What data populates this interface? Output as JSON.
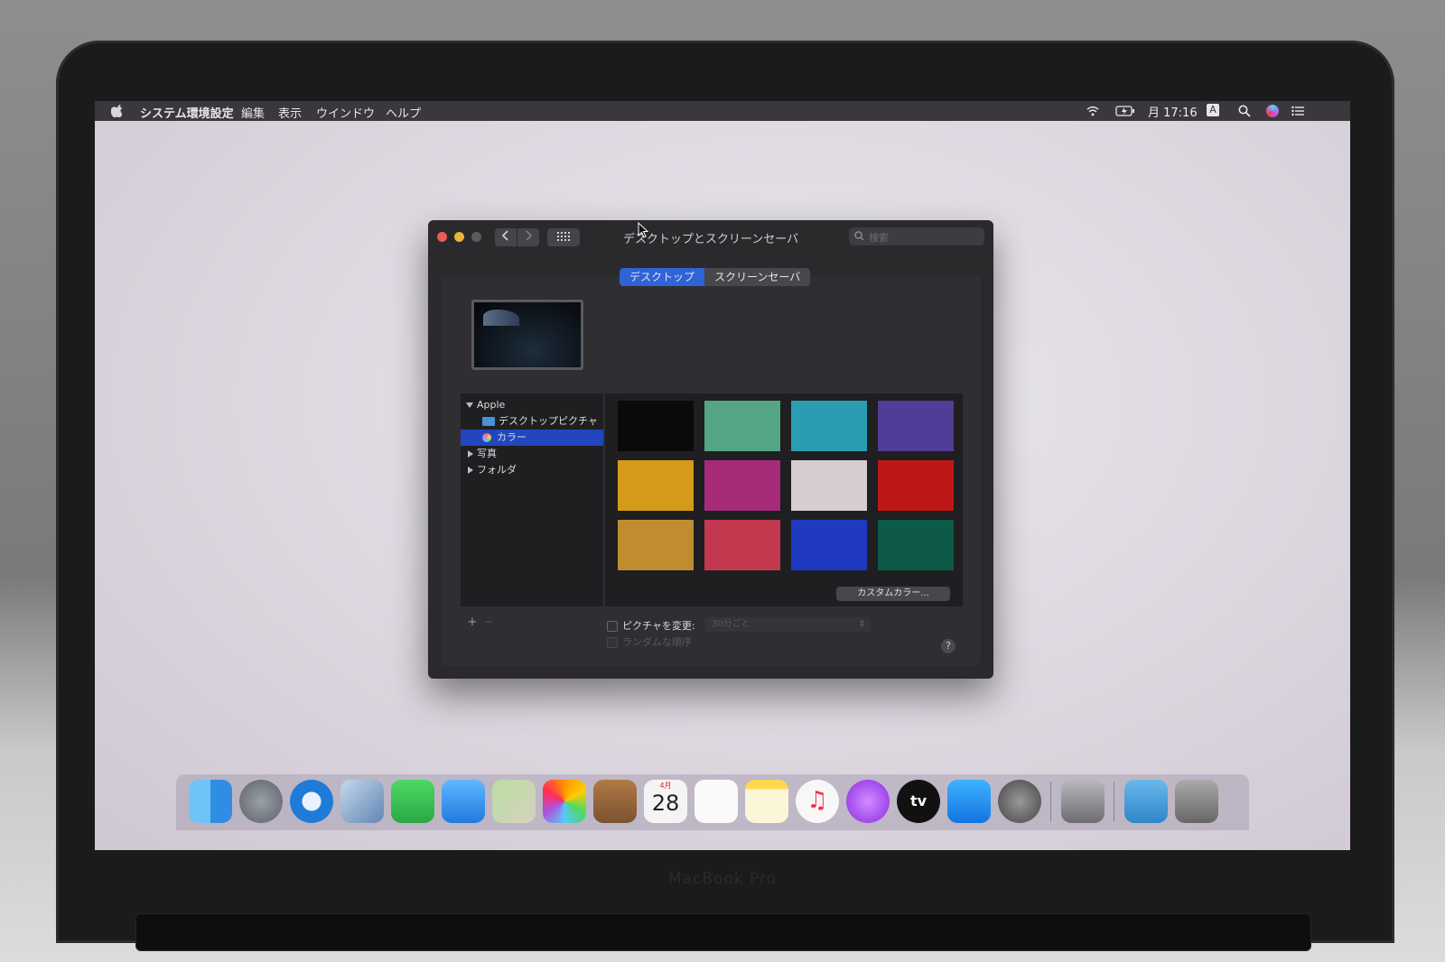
{
  "menubar": {
    "app_name": "システム環境設定",
    "items": [
      "編集",
      "表示",
      "ウインドウ",
      "ヘルプ"
    ],
    "clock": "月 17:16",
    "input_indicator": "A"
  },
  "window": {
    "title": "デスクトップとスクリーンセーバ",
    "search_placeholder": "検索",
    "tabs": {
      "desktop": "デスクトップ",
      "screensaver": "スクリーンセーバ"
    },
    "sidebar": {
      "apple": "Apple",
      "desktop_pictures": "デスクトップピクチャ",
      "colors": "カラー",
      "photos": "写真",
      "folders": "フォルダ"
    },
    "swatches": [
      "#0a0a0b",
      "#54a585",
      "#2a9db2",
      "#4f3d97",
      "#d69a19",
      "#a52b79",
      "#d6cdcf",
      "#be1717",
      "#bf8d2f",
      "#c2384f",
      "#1f3ac0",
      "#0d5a48"
    ],
    "custom_color_label": "カスタムカラー...",
    "add_label": "+",
    "remove_label": "−",
    "change_picture_label": "ピクチャを変更:",
    "interval_value": "30分ごと",
    "random_order_label": "ランダムな順序",
    "help_label": "?"
  },
  "dock_icons": [
    "finder-icon",
    "launchpad-icon",
    "safari-icon",
    "mail-icon",
    "facetime-icon",
    "messages-icon",
    "maps-icon",
    "photos-icon",
    "contacts-icon",
    "calendar-icon",
    "reminders-icon",
    "notes-icon",
    "music-icon",
    "podcasts-icon",
    "tv-icon",
    "app-store-icon",
    "system-preferences-icon",
    "automator-icon",
    "downloads-folder-icon",
    "trash-icon"
  ],
  "dock": {
    "calendar_day": "28",
    "calendar_month": "4月",
    "tv_label": "tv"
  },
  "laptop": {
    "model_label": "MacBook Pro"
  }
}
